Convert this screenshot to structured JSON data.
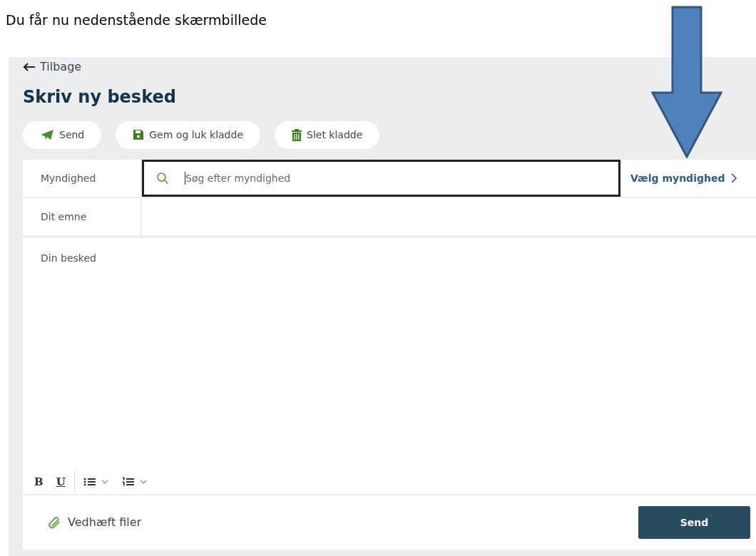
{
  "caption": "Du får nu nedenstående skærmbillede",
  "back_link": "Tilbage",
  "title": "Skriv ny besked",
  "actions": [
    {
      "label": "Send",
      "kind": "send"
    },
    {
      "label": "Gem og luk kladde",
      "kind": "save"
    },
    {
      "label": "Slet kladde",
      "kind": "trash"
    }
  ],
  "authority": {
    "label": "Myndighed",
    "placeholder": "Søg efter myndighed",
    "choose_link": "Vælg myndighed"
  },
  "subject": {
    "label": "Dit emne"
  },
  "message": {
    "placeholder": "Din besked"
  },
  "format_toolbar": {
    "bold": "B",
    "underline": "U"
  },
  "attach_link": "Vedhæft filer",
  "send_button": "Send"
}
